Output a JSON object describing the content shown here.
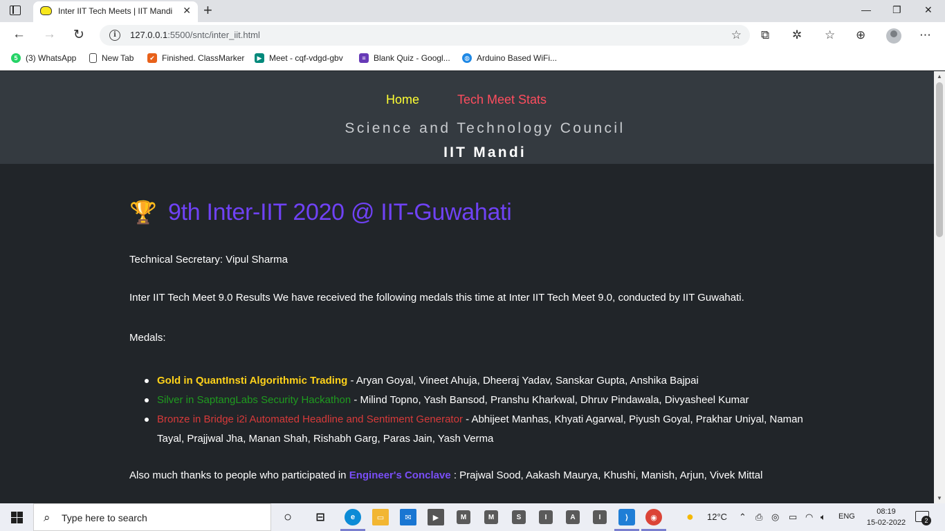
{
  "browser": {
    "tab_title": "Inter IIT Tech Meets | IIT Mandi",
    "tab_close": "✕",
    "new_tab": "+",
    "url_host": "127.0.0.1",
    "url_path": ":5500/sntc/inter_iit.html",
    "window_controls": {
      "minimize": "—",
      "maximize": "❐",
      "close": "✕"
    }
  },
  "bookmarks": [
    {
      "label": "(3) WhatsApp",
      "icon": "whatsapp-icon",
      "color": "#25d366",
      "glyph": "5"
    },
    {
      "label": "New Tab",
      "icon": "page-icon",
      "color": "#ffffff",
      "glyph": ""
    },
    {
      "label": "Finished. ClassMarker",
      "icon": "check-icon",
      "color": "#e8611a",
      "glyph": "✔"
    },
    {
      "label": "Meet - cqf-vdgd-gbv",
      "icon": "meet-icon",
      "color": "#00897b",
      "glyph": "▶"
    },
    {
      "label": "Blank Quiz - Googl...",
      "icon": "forms-icon",
      "color": "#673ab7",
      "glyph": "≡"
    },
    {
      "label": "Arduino Based WiFi...",
      "icon": "globe-icon",
      "color": "#1e88e5",
      "glyph": "◍"
    }
  ],
  "site": {
    "nav": {
      "home": "Home",
      "stats": "Tech Meet Stats"
    },
    "council": "Science and Technology Council",
    "institute": "IIT Mandi",
    "title": "9th Inter-IIT 2020 @ IIT-Guwahati",
    "trophy": "🏆",
    "secretary": "Technical Secretary: Vipul Sharma",
    "results": "Inter IIT Tech Meet 9.0 Results We have received the following medals this time at Inter IIT Tech Meet 9.0, conducted by IIT Guwahati.",
    "medals_label": "Medals:",
    "medals": [
      {
        "event": "Gold in QuantInsti Algorithmic Trading",
        "members": " - Aryan Goyal, Vineet Ahuja, Dheeraj Yadav, Sanskar Gupta, Anshika Bajpai"
      },
      {
        "event": "Silver in SaptangLabs Security Hackathon",
        "members": " - Milind Topno, Yash Bansod, Pranshu Kharkwal, Dhruv Pindawala, Divyasheel Kumar"
      },
      {
        "event": "Bronze in Bridge i2i Automated Headline and Sentiment Generator",
        "members": " - Abhijeet Manhas, Khyati Agarwal, Piyush Goyal, Prakhar Uniyal, Naman Tayal, Prajjwal Jha, Manan Shah, Rishabh Garg, Paras Jain, Yash Verma"
      }
    ],
    "thanks_prefix": "Also much thanks to people who participated in ",
    "thanks_link": "Engineer's Conclave",
    "thanks_suffix": " : Prajwal Sood, Aakash Maurya, Khushi, Manish, Arjun, Vivek Mittal"
  },
  "taskbar": {
    "search_placeholder": "Type here to search",
    "apps": [
      "M",
      "M",
      "S",
      "I",
      "A",
      "I"
    ],
    "weather": "12°C",
    "language": "ENG",
    "time": "08:19",
    "date": "15-02-2022",
    "notifications": "2"
  },
  "colors": {
    "header_bg": "#343a40",
    "page_bg": "#212529",
    "title": "#6f42f5",
    "gold": "#ffd21a",
    "silver": "#1f9b1f",
    "bronze": "#d83a3a",
    "nav_home": "#ffff33",
    "nav_stats": "#ff4d5e"
  }
}
